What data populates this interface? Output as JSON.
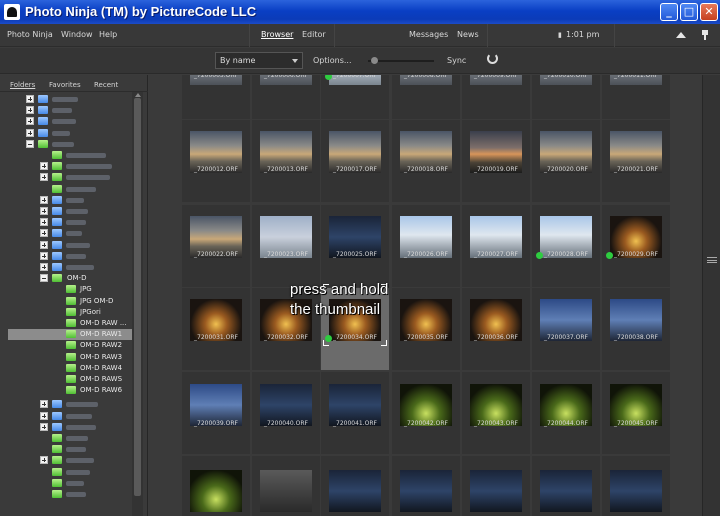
{
  "window": {
    "title": "Photo Ninja (TM) by PictureCode LLC"
  },
  "menus": [
    "Photo Ninja",
    "Window",
    "Help"
  ],
  "tabs": {
    "browser": "Browser",
    "editor": "Editor"
  },
  "right_menus": {
    "messages": "Messages",
    "news": "News"
  },
  "clock": "1:01 pm",
  "toolbar": {
    "sort": "By name",
    "options": "Options...",
    "sync": "Sync",
    "slider_level": 0.05
  },
  "left_tabs": {
    "folders": "Folders",
    "favorites": "Favorites",
    "recent": "Recent"
  },
  "tree": {
    "parent_folder": "OM-D",
    "children": [
      "JPG",
      "JPG OM-D",
      "JPGori",
      "OM-D RAW ...",
      "OM-D RAW1",
      "OM-D RAW2",
      "OM-D RAW3",
      "OM-D RAW4",
      "OM-D RAWS",
      "OM-D RAW6"
    ],
    "selected": "OM-D RAW1"
  },
  "overlay": {
    "line1": "press and hold",
    "line2": "the thumbnail"
  },
  "files": [
    [
      "_7200005.ORF",
      "_7200006.ORF",
      "_7200007.ORF",
      "_7200008.ORF",
      "_7200009.ORF",
      "_7200010.ORF",
      "_7200011.ORF"
    ],
    [
      "_7200012.ORF",
      "_7200013.ORF",
      "_7200017.ORF",
      "_7200018.ORF",
      "_7200019.ORF",
      "_7200020.ORF",
      "_7200021.ORF"
    ],
    [
      "_7200022.ORF",
      "_7200023.ORF",
      "_7200025.ORF",
      "_7200026.ORF",
      "_7200027.ORF",
      "_7200028.ORF",
      "_7200029.ORF"
    ],
    [
      "_7200031.ORF",
      "_7200032.ORF",
      "_7200034.ORF",
      "_7200035.ORF",
      "_7200036.ORF",
      "_7200037.ORF",
      "_7200038.ORF"
    ],
    [
      "_7200039.ORF",
      "_7200040.ORF",
      "_7200041.ORF",
      "_7200042.ORF",
      "_7200043.ORF",
      "_7200044.ORF",
      "_7200045.ORF"
    ]
  ],
  "selected_file": "_7200034.ORF"
}
